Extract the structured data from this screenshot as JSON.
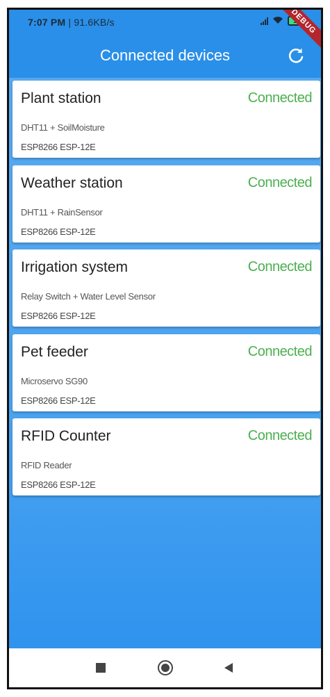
{
  "status_bar": {
    "time": "7:07 PM",
    "speed": " | 91.6KB/s",
    "battery": "15"
  },
  "debug_banner": "DEBUG",
  "app_bar": {
    "title": "Connected devices",
    "refresh_icon": "refresh-icon"
  },
  "colors": {
    "primary": "#2a8fe8",
    "connected": "#4caf50",
    "debug": "#b3262d"
  },
  "devices": [
    {
      "name": "Plant station",
      "status": "Connected",
      "sensor": "DHT11 + SoilMoisture",
      "board": "ESP8266 ESP-12E"
    },
    {
      "name": "Weather station",
      "status": "Connected",
      "sensor": "DHT11 + RainSensor",
      "board": "ESP8266 ESP-12E"
    },
    {
      "name": "Irrigation system",
      "status": "Connected",
      "sensor": "Relay Switch + Water Level Sensor",
      "board": "ESP8266 ESP-12E"
    },
    {
      "name": "Pet feeder",
      "status": "Connected",
      "sensor": "Microservo SG90",
      "board": "ESP8266 ESP-12E"
    },
    {
      "name": "RFID Counter",
      "status": "Connected",
      "sensor": "RFID Reader",
      "board": "ESP8266 ESP-12E"
    }
  ],
  "nav_bar": {
    "recents_icon": "square-icon",
    "home_icon": "circle-icon",
    "back_icon": "triangle-back-icon"
  }
}
